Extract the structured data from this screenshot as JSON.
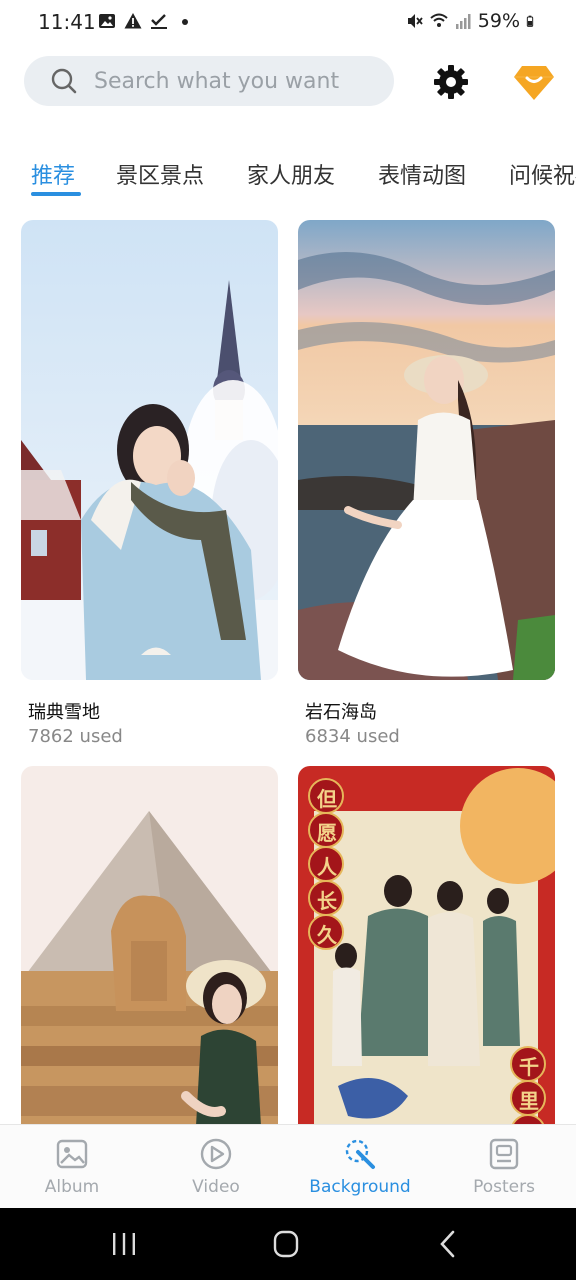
{
  "status_bar": {
    "time": "11:41",
    "battery": "59%"
  },
  "search": {
    "placeholder": "Search what you want"
  },
  "tabs": [
    {
      "label": "推荐",
      "active": true
    },
    {
      "label": "景区景点",
      "active": false
    },
    {
      "label": "家人朋友",
      "active": false
    },
    {
      "label": "表情动图",
      "active": false
    },
    {
      "label": "问候祝福",
      "active": false
    }
  ],
  "templates": [
    {
      "title": "瑞典雪地",
      "used": "7862 used"
    },
    {
      "title": "岩石海岛",
      "used": "6834 used"
    },
    {
      "title": "",
      "used": ""
    },
    {
      "title": "",
      "used": "",
      "poster_left_text": "但愿人长久",
      "poster_right_text": "千里共"
    }
  ],
  "bottom_nav": [
    {
      "label": "Album",
      "icon": "image-icon",
      "active": false
    },
    {
      "label": "Video",
      "icon": "play-circle-icon",
      "active": false
    },
    {
      "label": "Background",
      "icon": "magic-wand-icon",
      "active": true
    },
    {
      "label": "Posters",
      "icon": "poster-icon",
      "active": false
    }
  ],
  "colors": {
    "accent": "#2a8fe0",
    "search_bg": "#eaeef2",
    "vip_orange": "#f5a623",
    "inactive_nav": "#a4a9ae"
  }
}
